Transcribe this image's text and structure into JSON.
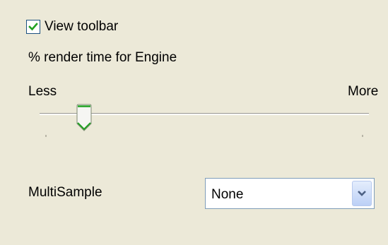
{
  "view_toolbar": {
    "label": "View toolbar",
    "checked": true
  },
  "render_time": {
    "label": "% render time for Engine",
    "min_label": "Less",
    "max_label": "More",
    "level": 0.12
  },
  "multisample": {
    "label": "MultiSample",
    "selected": "None"
  },
  "colors": {
    "background": "#ECE9D8",
    "check_mark": "#21A121",
    "thumb_accent": "#21A121",
    "dropdown_arrow": "#4D6185"
  },
  "icons": {
    "checkbox": "check-mark-icon",
    "dropdown": "chevron-down-icon"
  }
}
